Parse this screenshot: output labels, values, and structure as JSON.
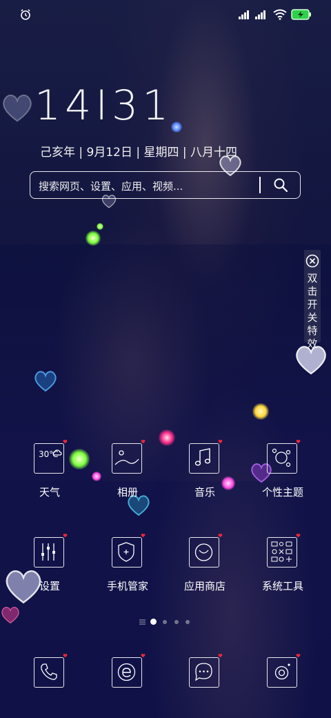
{
  "status_bar": {
    "icons": [
      "alarm-icon",
      "signal-icon",
      "signal-icon",
      "wifi-icon",
      "battery-charging-icon"
    ]
  },
  "clock": {
    "time": "14:31",
    "display": "14I31"
  },
  "date": {
    "text": "己亥年 | 9月12日 | 星期四 | 八月十四"
  },
  "search": {
    "placeholder": "搜索网页、设置、应用、视频..."
  },
  "effects_toggle": {
    "label": "双击开关特效"
  },
  "apps_row1": [
    {
      "label": "天气",
      "icon": "weather-icon",
      "temp": "30℃"
    },
    {
      "label": "相册",
      "icon": "gallery-icon"
    },
    {
      "label": "音乐",
      "icon": "music-icon"
    },
    {
      "label": "个性主题",
      "icon": "theme-icon"
    }
  ],
  "apps_row2": [
    {
      "label": "设置",
      "icon": "settings-icon"
    },
    {
      "label": "手机管家",
      "icon": "phone-manager-icon"
    },
    {
      "label": "应用商店",
      "icon": "app-store-icon"
    },
    {
      "label": "系统工具",
      "icon": "system-tools-icon"
    }
  ],
  "dock": [
    {
      "icon": "phone-icon"
    },
    {
      "icon": "browser-icon"
    },
    {
      "icon": "messages-icon"
    },
    {
      "icon": "camera-icon"
    }
  ],
  "page_indicator": {
    "pages": 4,
    "current": 1
  },
  "colors": {
    "text": "#ffffff",
    "badge": "#e8283c",
    "background": "#12164a"
  }
}
